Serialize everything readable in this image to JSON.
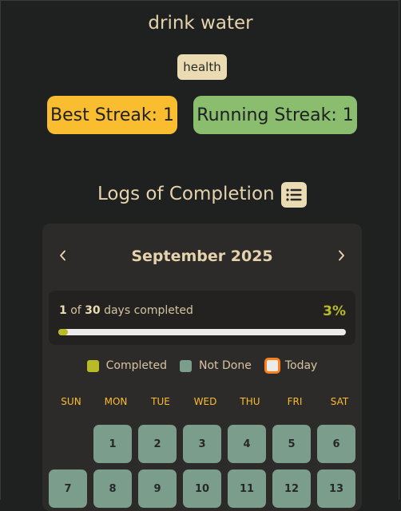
{
  "habit": {
    "title": "drink water",
    "tag": "health",
    "best_streak": "Best Streak: 1",
    "running_streak": "Running Streak: 1"
  },
  "logs": {
    "title": "Logs of Completion",
    "list_icon": "list-icon"
  },
  "calendar": {
    "month": "September 2025",
    "prev_icon": "chevron-left-icon",
    "next_icon": "chevron-right-icon",
    "progress": {
      "completed": "1",
      "of_text": "of",
      "total": "30",
      "suffix": "days completed",
      "percent": "3%",
      "fraction": 0.033
    },
    "legend": {
      "completed": "Completed",
      "not_done": "Not Done",
      "today": "Today"
    },
    "weekdays": [
      "SUN",
      "MON",
      "TUE",
      "WED",
      "THU",
      "FRI",
      "SAT"
    ],
    "leading_blanks": 1,
    "days": [
      "1",
      "2",
      "3",
      "4",
      "5",
      "6",
      "7",
      "8",
      "9",
      "10",
      "11",
      "12",
      "13"
    ]
  },
  "colors": {
    "background": "#1f2020",
    "card": "#2d2b29",
    "best_streak": "#fabd2f",
    "running_streak": "#8bbd6f",
    "completed": "#b8bb26",
    "not_done": "#7b9e8c",
    "today_border": "#fe8019",
    "weekday_label": "#fabd2f"
  }
}
